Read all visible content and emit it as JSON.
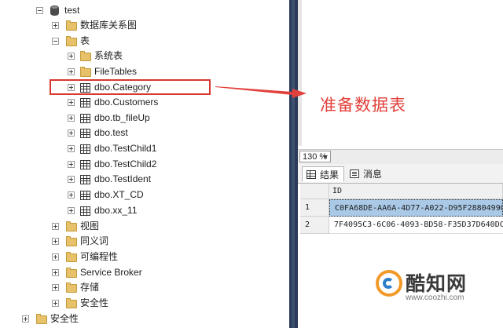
{
  "object_explorer": {
    "database": "test",
    "diagrams": "数据库关系图",
    "tables_folder": "表",
    "system_tables": "系统表",
    "file_tables": "FileTables",
    "tables": [
      "dbo.Category",
      "dbo.Customers",
      "dbo.tb_fileUp",
      "dbo.test",
      "dbo.TestChild1",
      "dbo.TestChild2",
      "dbo.TestIdent",
      "dbo.XT_CD",
      "dbo.xx_11"
    ],
    "highlighted_table": "dbo.Category",
    "views": "视图",
    "synonyms": "同义词",
    "programmability": "可编程性",
    "service_broker": "Service Broker",
    "storage": "存储",
    "db_security": "安全性",
    "server_security": "安全性"
  },
  "annotation": {
    "text": "准备数据表",
    "color": "#e2403a"
  },
  "query_window": {
    "zoom": "130 %",
    "tabs": [
      {
        "label": "结果",
        "icon": "grid-icon"
      },
      {
        "label": "消息",
        "icon": "message-icon"
      }
    ],
    "grid": {
      "columns": [
        "ID"
      ],
      "rows": [
        {
          "num": "1",
          "id": "C0FA68DE-AA6A-4D77-A022-D95F28804990"
        },
        {
          "num": "2",
          "id": "7F4095C3-6C06-4093-BD58-F35D37D640DC"
        }
      ]
    }
  },
  "watermark": {
    "name": "酷知网",
    "url": "www.coozhi.com"
  },
  "colors": {
    "highlight_border": "#d9372f",
    "selected_cell": "#a9c9e6",
    "splitter": "#2b3b5a"
  }
}
